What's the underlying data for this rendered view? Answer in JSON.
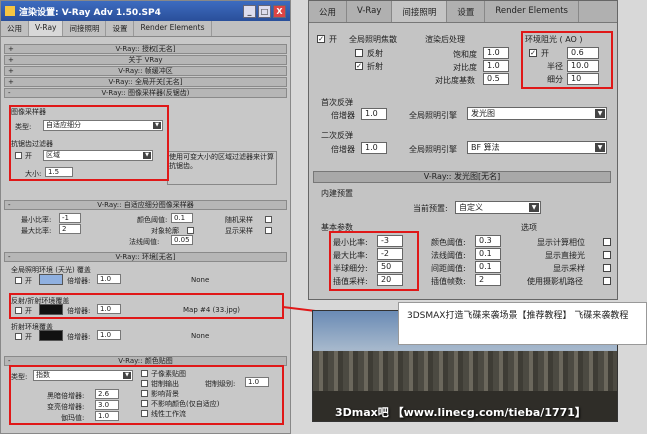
{
  "left": {
    "title": "渲染设置: V-Ray Adv 1.50.SP4",
    "win_min": "_",
    "win_max": "□",
    "win_close": "X",
    "tabs": [
      "公用",
      "V-Ray",
      "间接照明",
      "设置",
      "Render Elements"
    ],
    "rollouts": [
      "V-Ray:: 授权[无名]",
      "关于 VRay",
      "V-Ray:: 帧缓冲区",
      "V-Ray:: 全局开关[无名]",
      "V-Ray:: 图像采样器(反锯齿)"
    ],
    "image_sampler": {
      "group_label": "图像采样器",
      "type_label": "类型:",
      "type_value": "自适应细分",
      "aa_group_label": "抗锯齿过滤器",
      "on_label": "开",
      "filter_value": "区域",
      "filter_desc": "使用可变大小的区域过滤器来计算抗锯齿。",
      "size_label": "大小:",
      "size_value": "1.5"
    },
    "adaptive": {
      "header": "V-Ray:: 自适应细分图像采样器",
      "min_rate_label": "最小比率:",
      "min_rate": "-1",
      "max_rate_label": "最大比率:",
      "max_rate": "2",
      "clr_thresh_label": "颜色阈值:",
      "clr_thresh": "0.1",
      "obj_outline_label": "对象轮廓",
      "normal_thresh_label": "法线阈值:",
      "normal_thresh": "0.05",
      "rand_label": "随机采样",
      "show_samples_label": "显示采样"
    },
    "environment": {
      "header": "V-Ray:: 环境[无名]",
      "gi_env_label": "全局照明环境 (天光) 覆盖",
      "on_label": "开",
      "mult_label": "倍增器:",
      "mult_value": "1.0",
      "none_label": "None",
      "refl_label": "反射/折射环境覆盖",
      "refl_mult": "1.0",
      "map_label": "Map #4 (33.jpg)",
      "refr_label": "折射环境覆盖",
      "refr_mult": "1.0"
    },
    "color_mapping": {
      "header": "V-Ray:: 颜色贴图",
      "type_label": "类型:",
      "type_value": "指数",
      "sub_pixel_label": "子像素贴图",
      "clamp_label": "钳制输出",
      "clamp_level_label": "钳制级别:",
      "clamp_level": "1.0",
      "affect_bg_label": "影响背景",
      "dark_label": "黑暗倍增器:",
      "dark_value": "2.6",
      "bright_label": "变亮倍增器:",
      "bright_value": "3.0",
      "gamma_label": "伽玛值:",
      "gamma_value": "1.0",
      "no_affect_label": "不影响颜色(仅自适应)",
      "linear_label": "线性工作流"
    }
  },
  "right": {
    "tabs": [
      "公用",
      "V-Ray",
      "间接照明",
      "设置",
      "Render Elements"
    ],
    "on_label": "开",
    "gi_caustics_label": "全局照明焦散",
    "reflective_label": "反射",
    "refractive_label": "折射",
    "post_label": "渲染后处理",
    "saturation_label": "饱和度",
    "saturation": "1.0",
    "contrast_label": "对比度",
    "contrast": "1.0",
    "contrast_base_label": "对比度基数",
    "contrast_base": "0.5",
    "ao_label": "环境阻光 ( AO )",
    "ao_on_label": "开",
    "ao_amount": "0.6",
    "radius_label": "半径",
    "radius": "10.0",
    "subdivs_label": "细分",
    "subdivs": "10",
    "primary_label": "首次反弹",
    "primary_mult_label": "倍增器",
    "primary_mult": "1.0",
    "primary_engine_label": "全局照明引擎",
    "primary_engine": "发光图",
    "secondary_label": "二次反弹",
    "secondary_mult_label": "倍增器",
    "secondary_mult": "1.0",
    "secondary_engine_label": "全局照明引擎",
    "secondary_engine": "BF 算法",
    "irr_header": "V-Ray:: 发光图[无名]",
    "builtin_label": "内建预置",
    "preset_label": "当前预置:",
    "preset_value": "自定义",
    "basic_label": "基本参数",
    "options_label": "选项",
    "min_rate_label": "最小比率:",
    "min_rate": "-3",
    "max_rate_label": "最大比率:",
    "max_rate": "-2",
    "hsph_label": "半球细分:",
    "hsph": "50",
    "interp_label": "插值采样:",
    "interp": "20",
    "clr_label": "颜色阈值:",
    "clr": "0.3",
    "nrm_label": "法线阈值:",
    "nrm": "0.1",
    "dist_label": "间距阈值:",
    "dist": "0.1",
    "interp_frames_label": "插值帧数:",
    "interp_frames": "2",
    "show_calc_label": "显示计算相位",
    "show_direct_label": "显示直接光",
    "show_samples_label": "显示采样",
    "use_cam_label": "使用摄影机路径"
  },
  "tooltip": "3DSMAX打造飞碟来袭场景【推荐教程】 飞碟来袭教程",
  "watermark": "3Dmax吧 【www.linecg.com/tieba/1771】",
  "colors": {
    "highlight": "#e01818",
    "titlebar": "#2a4f9a"
  }
}
